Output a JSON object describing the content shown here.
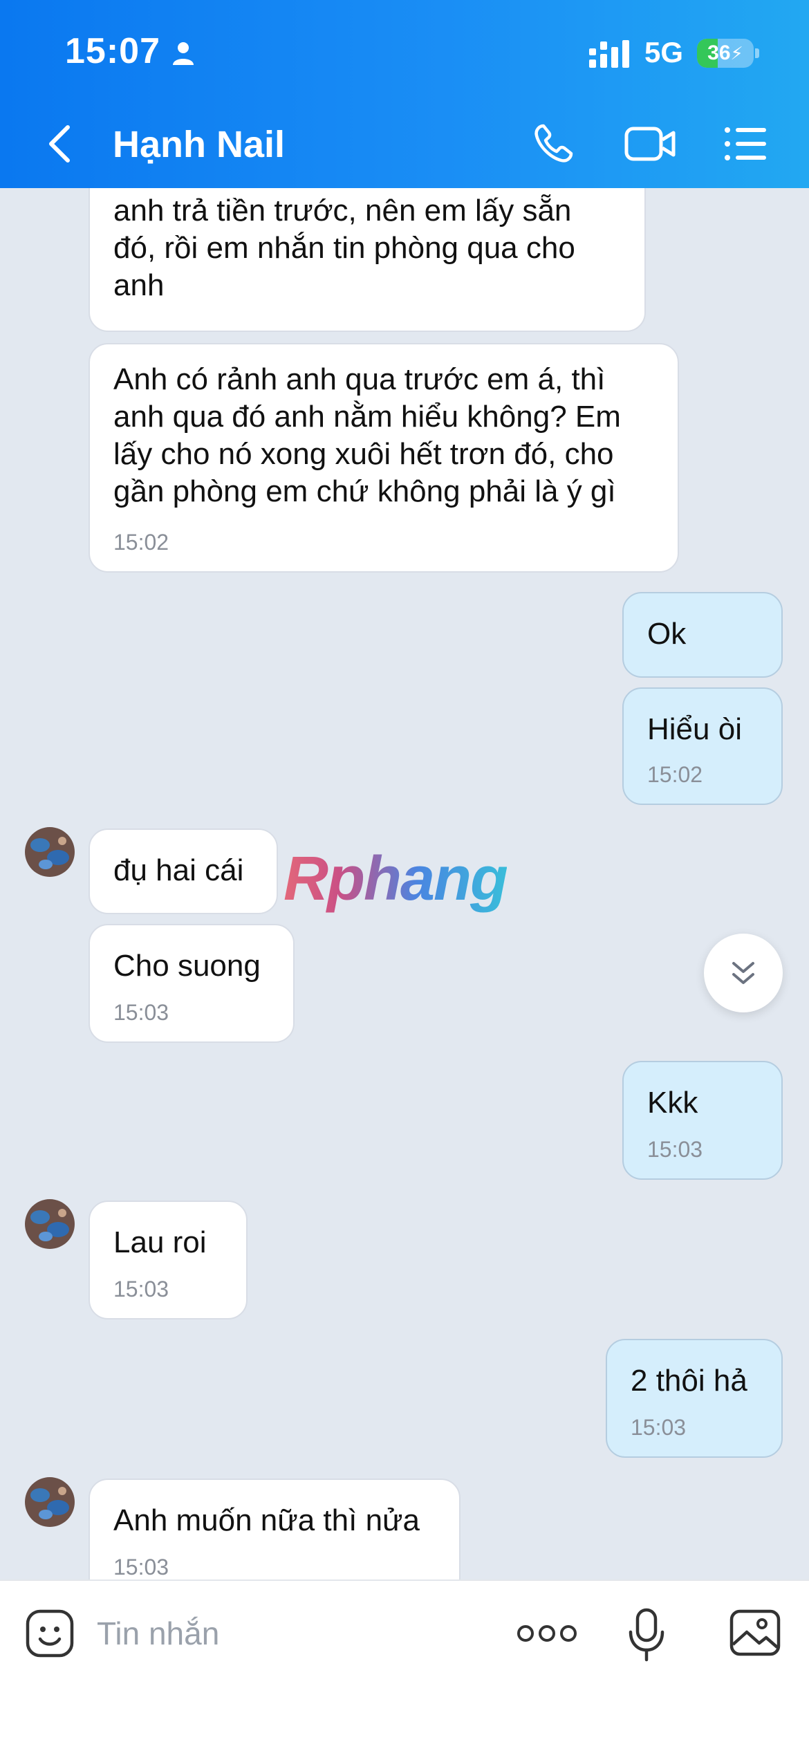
{
  "status_bar": {
    "time": "15:07",
    "network": "5G",
    "battery": "36",
    "battery_level": 0.36
  },
  "header": {
    "title": "Hạnh Nail",
    "icons": [
      "back-icon",
      "phone-icon",
      "video-call-icon",
      "list-menu-icon"
    ]
  },
  "messages": [
    {
      "from": "them",
      "text": "anh trả tiền trước, nên em lấy sẵn đó, rồi em nhắn tin phòng qua cho anh",
      "time": ""
    },
    {
      "from": "them",
      "text": "Anh có rảnh anh qua trước em á, thì anh qua đó anh nằm hiểu không? Em lấy cho nó xong xuôi hết trơn đó, cho gần phòng em chứ không phải là ý gì",
      "time": "15:02"
    },
    {
      "from": "me",
      "text": "Ok",
      "time": ""
    },
    {
      "from": "me",
      "text": "Hiểu òi",
      "time": "15:02"
    },
    {
      "from": "them",
      "text": "đụ hai cái",
      "time": ""
    },
    {
      "from": "them",
      "text": "Cho suong",
      "time": "15:03"
    },
    {
      "from": "me",
      "text": "Kkk",
      "time": "15:03"
    },
    {
      "from": "them",
      "text": "Lau roi",
      "time": "15:03"
    },
    {
      "from": "me",
      "text": "2 thôi hả",
      "time": "15:03"
    },
    {
      "from": "them",
      "text": "Anh muốn nữa thì nửa",
      "time": "15:03"
    }
  ],
  "watermark": "Rphang",
  "composer": {
    "placeholder": "Tin nhắn"
  },
  "colors": {
    "header_start": "#0a78f0",
    "header_end": "#22a8f2",
    "background": "#e2e8f0",
    "incoming_bubble": "#ffffff",
    "outgoing_bubble": "#d5eefc"
  }
}
